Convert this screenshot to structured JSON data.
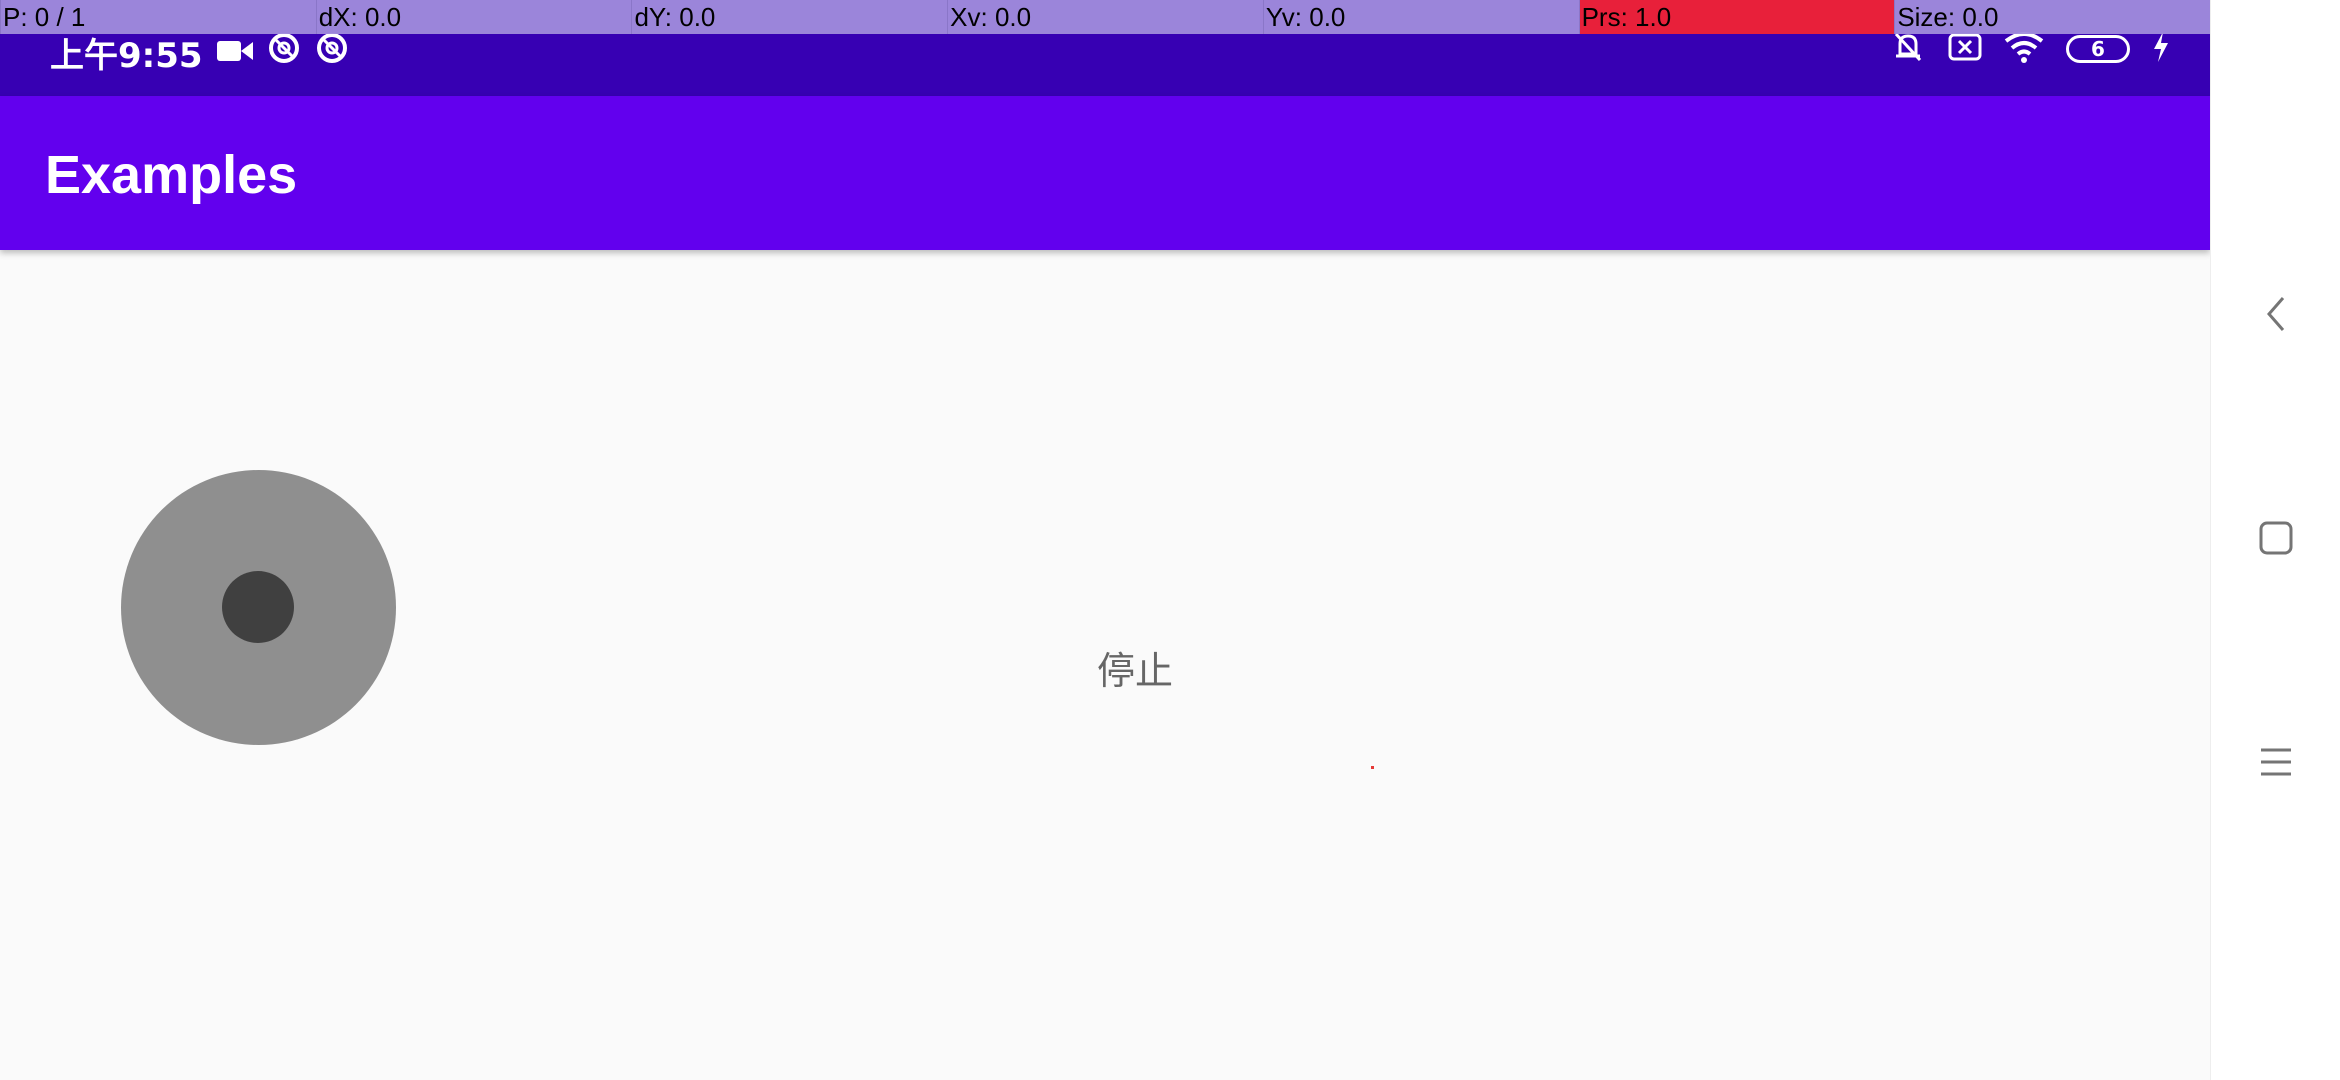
{
  "status_bar": {
    "time": "上午9:55",
    "battery_level": "6",
    "left_icons": [
      "video-camera-icon",
      "sync-icon",
      "sync-icon"
    ],
    "right_icons": [
      "muted-bell-icon",
      "no-sim-icon",
      "wifi-icon",
      "battery-icon",
      "charging-icon"
    ]
  },
  "pointer_overlay": {
    "cells": [
      "P: 0 / 1",
      "dX: 0.0",
      "dY: 0.0",
      "Xv: 0.0",
      "Yv: 0.0",
      "Prs: 1.0",
      "Size: 0.0"
    ],
    "highlight_color": "#e8203a"
  },
  "app_bar": {
    "title": "Examples",
    "color": "#6200ee"
  },
  "content": {
    "status_text": "停止"
  },
  "nav_bar": {
    "buttons": [
      "back-icon",
      "home-icon",
      "recents-icon"
    ]
  },
  "colors": {
    "status_bar": "#3700b3",
    "app_bar": "#6200ee",
    "background": "#fafafa",
    "joystick_base": "#8f8f8f",
    "joystick_knob": "#404040"
  }
}
